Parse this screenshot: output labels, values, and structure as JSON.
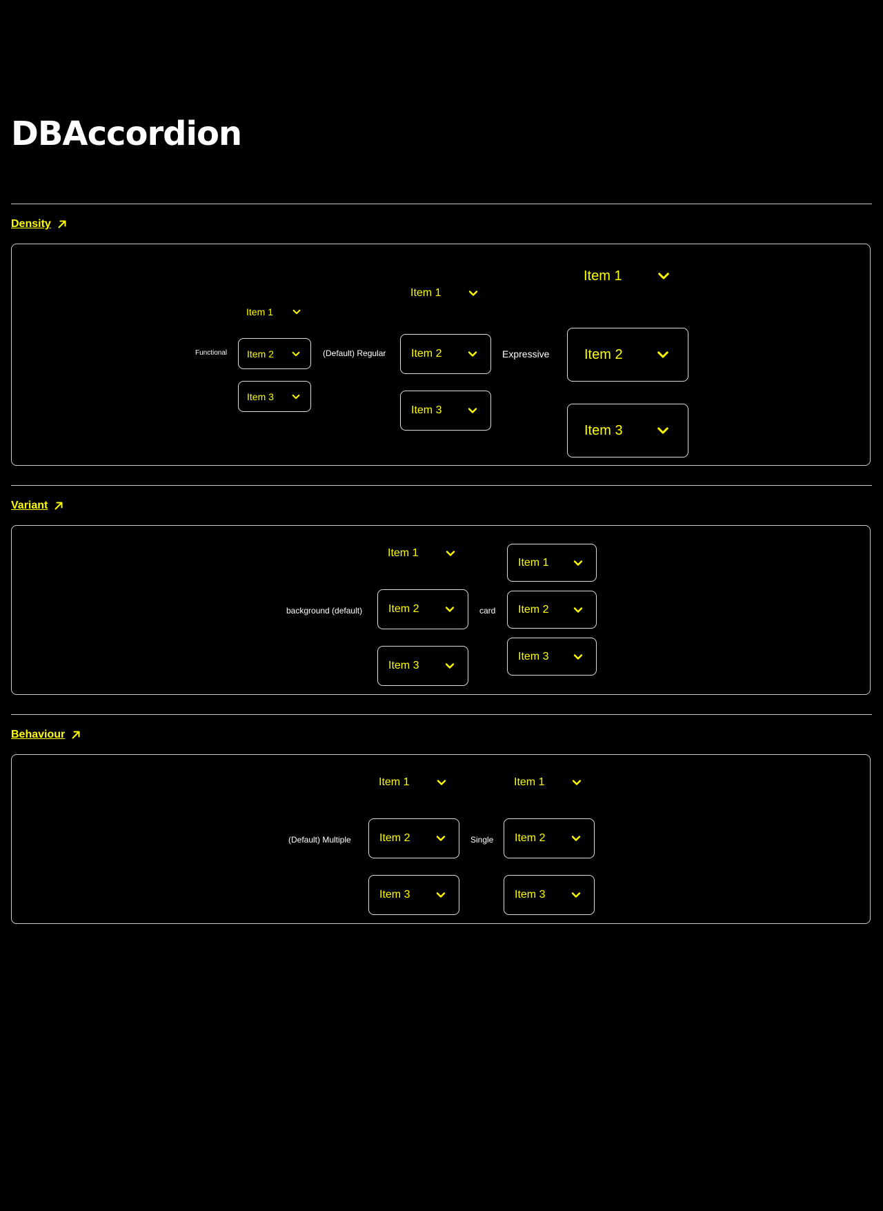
{
  "page": {
    "title": "DBAccordion"
  },
  "colors": {
    "background": "#000000",
    "text": "#ffffff",
    "accent": "#ffff00",
    "border": "#cccccc"
  },
  "icons": {
    "section_link": "arrow-up-right-icon",
    "accordion_toggle": "chevron-down-icon"
  },
  "sections": [
    {
      "title": "Density",
      "rows": [
        {
          "label": "Functional",
          "items": [
            "Item 1",
            "Item 2",
            "Item 3"
          ]
        },
        {
          "label": "(Default) Regular",
          "items": [
            "Item 1",
            "Item 2",
            "Item 3"
          ]
        },
        {
          "label": "Expressive",
          "items": [
            "Item 1",
            "Item 2",
            "Item 3"
          ]
        }
      ]
    },
    {
      "title": "Variant",
      "rows": [
        {
          "label": "background (default)",
          "items": [
            "Item 1",
            "Item 2",
            "Item 3"
          ]
        },
        {
          "label": "card",
          "items": [
            "Item 1",
            "Item 2",
            "Item 3"
          ]
        }
      ]
    },
    {
      "title": "Behaviour",
      "rows": [
        {
          "label": "(Default) Multiple",
          "items": [
            "Item 1",
            "Item 2",
            "Item 3"
          ]
        },
        {
          "label": "Single",
          "items": [
            "Item 1",
            "Item 2",
            "Item 3"
          ]
        }
      ]
    }
  ]
}
